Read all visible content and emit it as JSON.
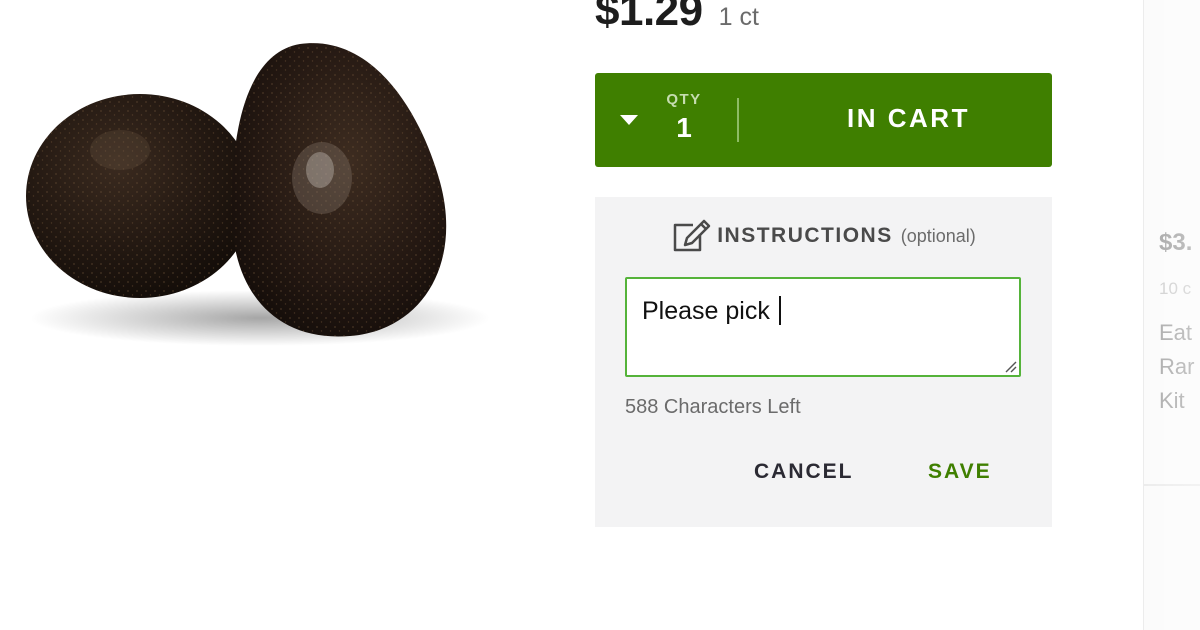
{
  "product": {
    "image_alt": "avocados",
    "price": "$1.29",
    "unit": "1 ct"
  },
  "cart": {
    "qty_caption": "QTY",
    "qty_value": "1",
    "status_label": "IN CART",
    "toggle_icon": "caret-down-icon",
    "background_color": "#3f7f00"
  },
  "instructions": {
    "icon": "edit-icon",
    "title": "INSTRUCTIONS",
    "optional_label": "(optional)",
    "value": "Please pick",
    "characters_left": "588 Characters Left",
    "cancel_label": "CANCEL",
    "save_label": "SAVE",
    "input_border_color": "#55b33a"
  },
  "next_product": {
    "price": "$3.",
    "unit": "10 c",
    "name_lines": [
      "Eat",
      "Rar",
      "Kit"
    ]
  }
}
